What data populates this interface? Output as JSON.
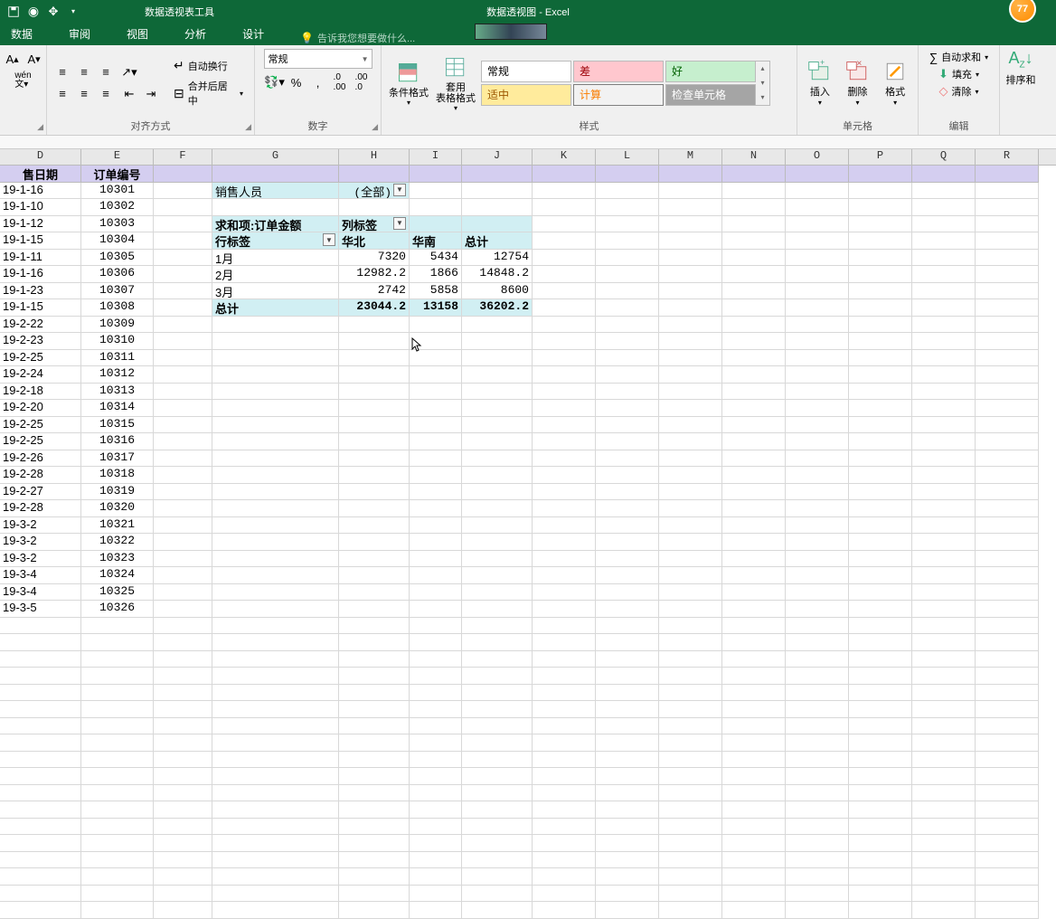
{
  "titlebar": {
    "tool_title": "数据透视表工具",
    "doc_title": "数据透视图 - Excel",
    "badge": "77"
  },
  "tabs": {
    "data": "数据",
    "review": "审阅",
    "view": "视图",
    "analyze": "分析",
    "design": "设计",
    "tell_me": "告诉我您想要做什么..."
  },
  "ribbon": {
    "wen": "wén\n文",
    "wrap": "自动换行",
    "merge": "合并后居中",
    "align_label": "对齐方式",
    "num_format": "常规",
    "num_label": "数字",
    "cond_fmt": "条件格式",
    "table_fmt": "套用\n表格格式",
    "styles_label": "样式",
    "style_normal": "常规",
    "style_bad": "差",
    "style_good": "好",
    "style_neutral": "适中",
    "style_calc": "计算",
    "style_check": "检查单元格",
    "insert": "插入",
    "delete": "删除",
    "format": "格式",
    "cells_label": "单元格",
    "autosum": "自动求和",
    "fill": "填充",
    "clear": "清除",
    "edit_label": "编辑",
    "sort": "排序和"
  },
  "columns": [
    "D",
    "E",
    "F",
    "G",
    "H",
    "I",
    "J",
    "K",
    "L",
    "M",
    "N",
    "O",
    "P",
    "Q",
    "R"
  ],
  "header_row": {
    "d": "售日期",
    "e": "订单编号"
  },
  "pivot": {
    "filter_label": "销售人员",
    "filter_value": "(全部)",
    "value_field": "求和项:订单金额",
    "col_label": "列标签",
    "row_label": "行标签",
    "col1": "华北",
    "col2": "华南",
    "col3": "总计",
    "r1": {
      "lbl": "1月",
      "c1": "7320",
      "c2": "5434",
      "c3": "12754"
    },
    "r2": {
      "lbl": "2月",
      "c1": "12982.2",
      "c2": "1866",
      "c3": "14848.2"
    },
    "r3": {
      "lbl": "3月",
      "c1": "2742",
      "c2": "5858",
      "c3": "8600"
    },
    "total": {
      "lbl": "总计",
      "c1": "23044.2",
      "c2": "13158",
      "c3": "36202.2"
    }
  },
  "rows": [
    {
      "d": "19-1-16",
      "e": "10301"
    },
    {
      "d": "19-1-10",
      "e": "10302"
    },
    {
      "d": "19-1-12",
      "e": "10303"
    },
    {
      "d": "19-1-15",
      "e": "10304"
    },
    {
      "d": "19-1-11",
      "e": "10305"
    },
    {
      "d": "19-1-16",
      "e": "10306"
    },
    {
      "d": "19-1-23",
      "e": "10307"
    },
    {
      "d": "19-1-15",
      "e": "10308"
    },
    {
      "d": "19-2-22",
      "e": "10309"
    },
    {
      "d": "19-2-23",
      "e": "10310"
    },
    {
      "d": "19-2-25",
      "e": "10311"
    },
    {
      "d": "19-2-24",
      "e": "10312"
    },
    {
      "d": "19-2-18",
      "e": "10313"
    },
    {
      "d": "19-2-20",
      "e": "10314"
    },
    {
      "d": "19-2-25",
      "e": "10315"
    },
    {
      "d": "19-2-25",
      "e": "10316"
    },
    {
      "d": "19-2-26",
      "e": "10317"
    },
    {
      "d": "19-2-28",
      "e": "10318"
    },
    {
      "d": "19-2-27",
      "e": "10319"
    },
    {
      "d": "19-2-28",
      "e": "10320"
    },
    {
      "d": "19-3-2",
      "e": "10321"
    },
    {
      "d": "19-3-2",
      "e": "10322"
    },
    {
      "d": "19-3-2",
      "e": "10323"
    },
    {
      "d": "19-3-4",
      "e": "10324"
    },
    {
      "d": "19-3-4",
      "e": "10325"
    },
    {
      "d": "19-3-5",
      "e": "10326"
    }
  ],
  "col_widths": {
    "D": 90,
    "E": 80,
    "F": 65,
    "G": 140,
    "H": 78,
    "I": 58,
    "J": 78,
    "rest": 70
  }
}
